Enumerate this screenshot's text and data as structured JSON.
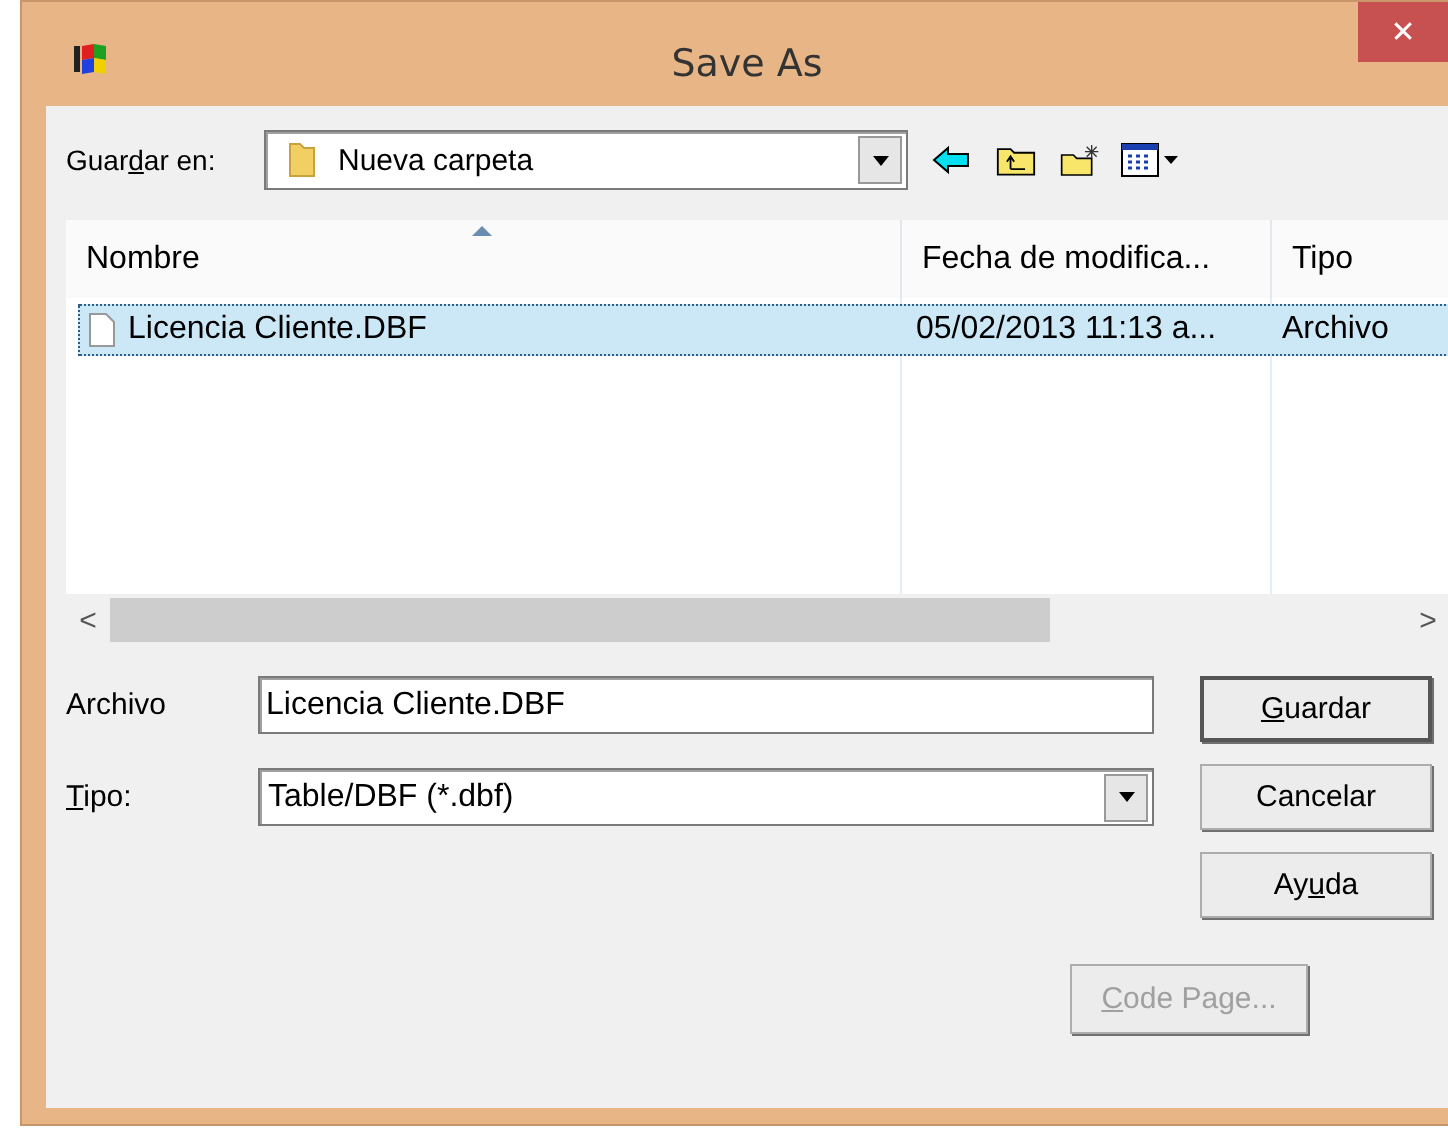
{
  "window": {
    "title": "Save As",
    "close_glyph": "✕"
  },
  "location": {
    "label": [
      {
        "text": "Guar",
        "underlined": false
      },
      {
        "text": "d",
        "underlined": true
      },
      {
        "text": "ar en:",
        "underlined": false
      }
    ],
    "value": "Nueva carpeta"
  },
  "file_list": {
    "columns": [
      {
        "label": "Nombre",
        "sorted": true
      },
      {
        "label": "Fecha de modifica...",
        "sorted": false
      },
      {
        "label": "Tipo",
        "sorted": false
      }
    ],
    "rows": [
      {
        "cells": [
          "Licencia Cliente.DBF",
          "05/02/2013 11:13 a...",
          "Archivo"
        ],
        "selected": true
      }
    ],
    "scroll_left": "<",
    "scroll_right": ">"
  },
  "file_name": {
    "label": [
      {
        "text": "Archivo",
        "underlined": false
      }
    ],
    "value": "Licencia Cliente.DBF"
  },
  "file_type": {
    "label": [
      {
        "text": "T",
        "underlined": true
      },
      {
        "text": "ipo:",
        "underlined": false
      }
    ],
    "value": "Table/DBF (*.dbf)"
  },
  "buttons": [
    {
      "label": [
        {
          "text": "G",
          "underlined": true
        },
        {
          "text": "uardar",
          "underlined": false
        }
      ],
      "default": true,
      "disabled": false
    },
    {
      "label": [
        {
          "text": "Cancelar",
          "underlined": false
        }
      ],
      "default": false,
      "disabled": false
    },
    {
      "label": [
        {
          "text": "Ay",
          "underlined": false
        },
        {
          "text": "u",
          "underlined": true
        },
        {
          "text": "da",
          "underlined": false
        }
      ],
      "default": false,
      "disabled": false
    },
    {
      "label": [
        {
          "text": "C",
          "underlined": true
        },
        {
          "text": "ode Page...",
          "underlined": false
        }
      ],
      "default": false,
      "disabled": true
    }
  ]
}
